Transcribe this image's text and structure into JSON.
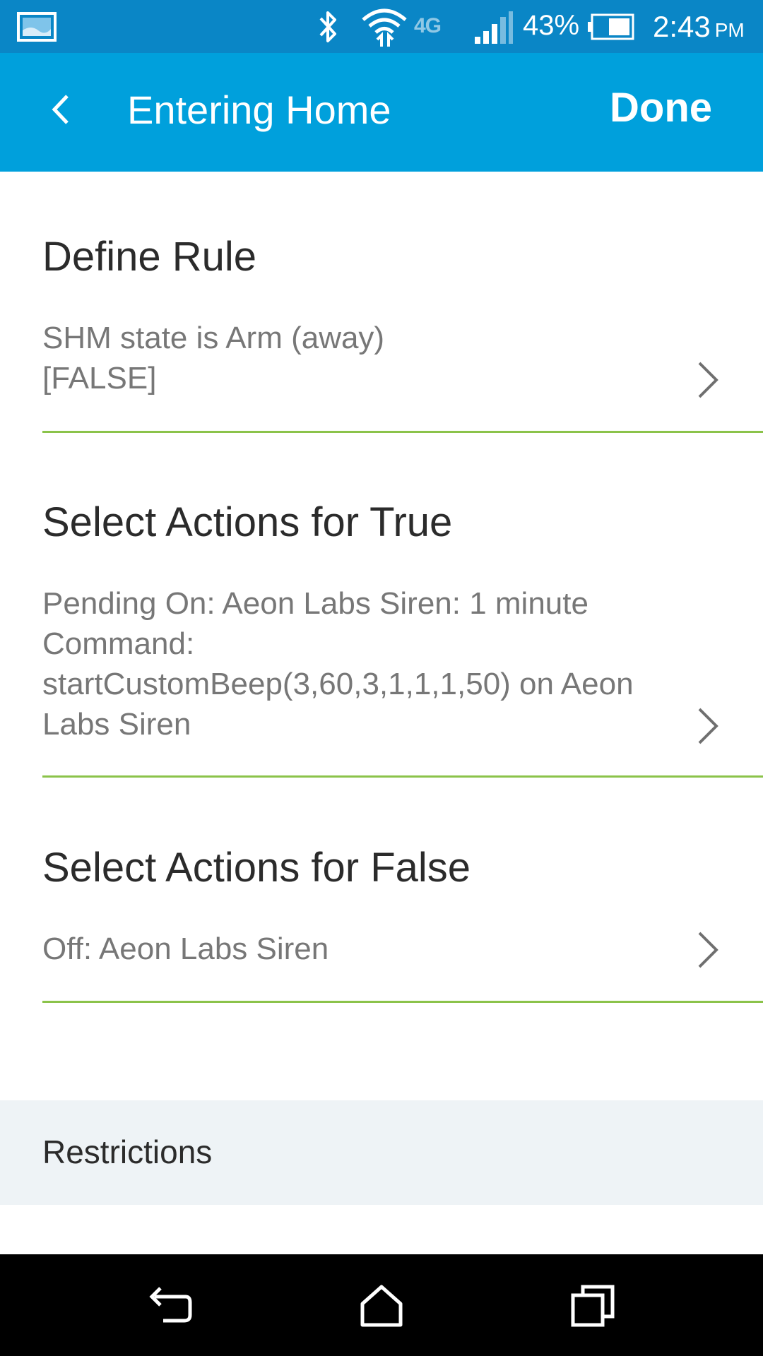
{
  "status_bar": {
    "battery_percent": "43%",
    "time": "2:43",
    "ampm": "PM",
    "network": "4G"
  },
  "app_bar": {
    "title": "Entering Home",
    "done_label": "Done"
  },
  "sections": {
    "define_rule": {
      "heading": "Define Rule",
      "line1": "SHM state is Arm (away)",
      "line2": "[FALSE]"
    },
    "actions_true": {
      "heading": "Select Actions for True",
      "line1": "Pending On: Aeon Labs Siren: 1 minute",
      "line2": "Command:",
      "line3": "startCustomBeep(3,60,3,1,1,1,50) on Aeon",
      "line4": "Labs Siren"
    },
    "actions_false": {
      "heading": "Select Actions for False",
      "line1": "Off: Aeon Labs Siren"
    }
  },
  "restrictions": {
    "label": "Restrictions"
  },
  "colors": {
    "status_bar": "#0a86c6",
    "app_bar": "#00a0dc",
    "divider": "#8bc34a",
    "restrictions_bg": "#eef3f6"
  }
}
